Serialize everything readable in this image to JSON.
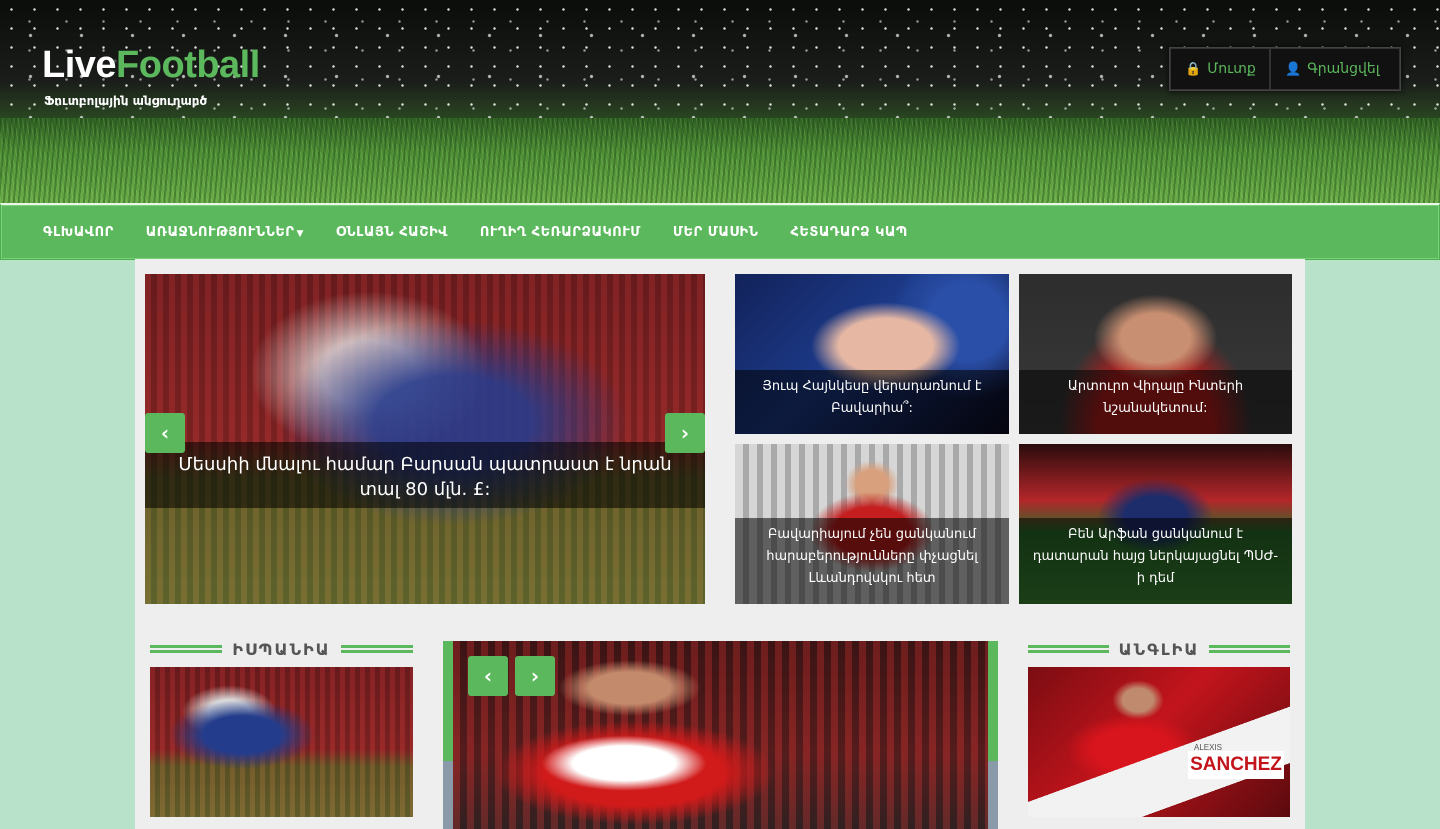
{
  "site": {
    "logo_part1": "Live",
    "logo_part2": "Football",
    "tagline": "Ֆուտբոլային անցուղարծ",
    "brand_color": "#5cb85c"
  },
  "auth": {
    "login_label": "Մուտք",
    "login_icon": "lock-icon",
    "register_label": "Գրանցվել",
    "register_icon": "user-icon"
  },
  "nav": {
    "items": [
      {
        "label": "ԳԼԽԱՎՈՐ"
      },
      {
        "label": "ԱՌԱՋՆՈՒԹՅՈՒՆՆԵՐ",
        "has_dropdown": true
      },
      {
        "label": "ՕՆԼԱՅՆ ՀԱՇԻՎ"
      },
      {
        "label": "ՈՒՂԻՂ ՀԵՌԱՐՁԱԿՈՒՄ"
      },
      {
        "label": "ՄԵՐ ՄԱՍԻՆ"
      },
      {
        "label": "ՀԵՏԱԴԱՐՁ ԿԱՊ"
      }
    ]
  },
  "featured": {
    "main_caption": "Մեսսիի մնալու համար Բարսան պատրաստ է նրան տալ 80 մլն. £:",
    "tiles": [
      {
        "caption": "Յուպ Հայնկեսը վերադառնում է Բավարիա՞:"
      },
      {
        "caption": "Արտուրո Վիդալը Ինտերի նշանակետում:"
      },
      {
        "caption": "Բավարիայում չեն ցանկանում հարաբերությունները փչացնել Լևանդովսկու հետ"
      },
      {
        "caption": "Բեն Արֆան ցանկանում է դատարան հայց ներկայացնել ՊՍԺ-ի դեմ"
      }
    ]
  },
  "sections": {
    "spain_title": "ԻՍՊԱՆԻԱ",
    "england_title": "ԱՆԳԼԻԱ",
    "england_thumb_text": "SANCHEZ",
    "england_thumb_small": "ALEXIS"
  }
}
